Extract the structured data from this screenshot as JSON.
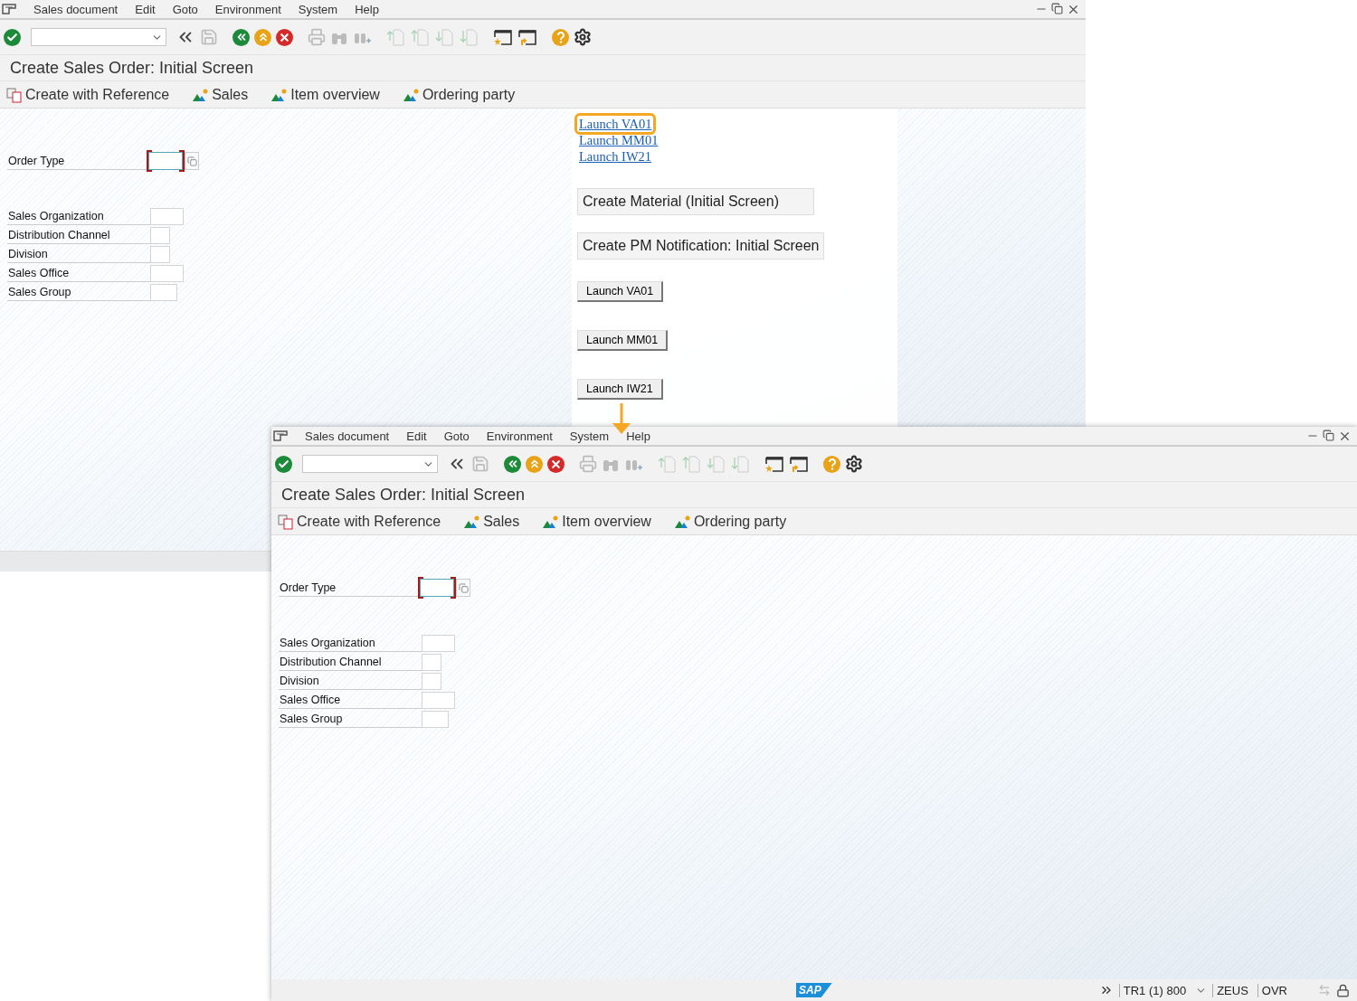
{
  "windows": [
    {
      "menu": [
        "Sales document",
        "Edit",
        "Goto",
        "Environment",
        "System",
        "Help"
      ],
      "title": "Create Sales Order: Initial Screen",
      "app_toolbar": [
        {
          "kind": "reference",
          "label": "Create with Reference"
        },
        {
          "kind": "screen",
          "label": "Sales"
        },
        {
          "kind": "screen",
          "label": "Item overview"
        },
        {
          "kind": "screen",
          "label": "Ordering party"
        }
      ],
      "fields": [
        {
          "label": "Order Type",
          "kind": "focused"
        },
        {
          "label": "Sales Organization",
          "kind": "plain"
        },
        {
          "label": "Distribution Channel",
          "kind": "plain"
        },
        {
          "label": "Division",
          "kind": "plain"
        },
        {
          "label": "Sales Office",
          "kind": "plain"
        },
        {
          "label": "Sales Group",
          "kind": "plain"
        }
      ],
      "html_panel": {
        "links": [
          {
            "label": "Launch VA01",
            "highlighted": true
          },
          {
            "label": "Launch MM01",
            "highlighted": false
          },
          {
            "label": "Launch IW21",
            "highlighted": false
          }
        ],
        "boxes": [
          "Create Material (Initial Screen)",
          "Create PM Notification: Initial Screen"
        ],
        "buttons": [
          "Launch VA01",
          "Launch MM01",
          "Launch IW21"
        ]
      }
    },
    {
      "menu": [
        "Sales document",
        "Edit",
        "Goto",
        "Environment",
        "System",
        "Help"
      ],
      "title": "Create Sales Order: Initial Screen",
      "app_toolbar": [
        {
          "kind": "reference",
          "label": "Create with Reference"
        },
        {
          "kind": "screen",
          "label": "Sales"
        },
        {
          "kind": "screen",
          "label": "Item overview"
        },
        {
          "kind": "screen",
          "label": "Ordering party"
        }
      ],
      "fields": [
        {
          "label": "Order Type",
          "kind": "focused"
        },
        {
          "label": "Sales Organization",
          "kind": "plain"
        },
        {
          "label": "Distribution Channel",
          "kind": "plain"
        },
        {
          "label": "Division",
          "kind": "plain"
        },
        {
          "label": "Sales Office",
          "kind": "plain"
        },
        {
          "label": "Sales Group",
          "kind": "plain"
        }
      ],
      "status_bar": {
        "logo": "SAP",
        "items": [
          "TR1 (1) 800",
          "ZEUS",
          "OVR"
        ]
      }
    }
  ]
}
